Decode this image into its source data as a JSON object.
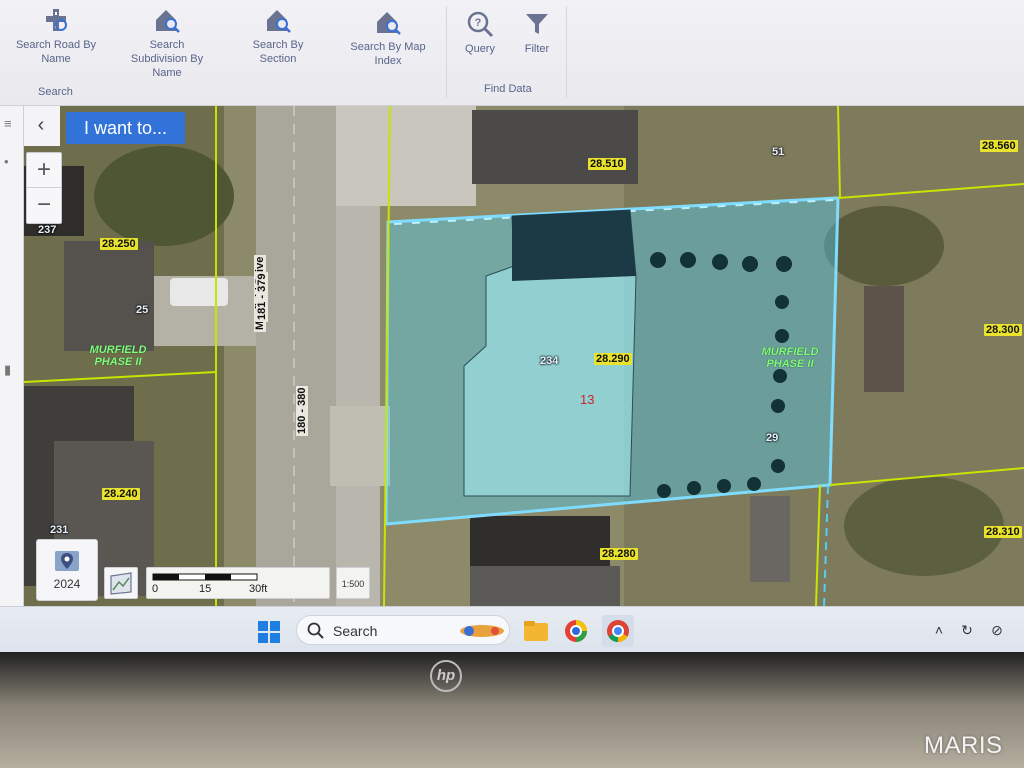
{
  "ribbon": {
    "search_group": {
      "label": "Search",
      "buttons": [
        {
          "label": "Search Road By Name",
          "icon": "road-icon"
        },
        {
          "label": "Search Subdivision By Name",
          "icon": "house-search-icon"
        },
        {
          "label": "Search By Section",
          "icon": "house-search-icon"
        },
        {
          "label": "Search By Map Index",
          "icon": "house-search-icon"
        }
      ]
    },
    "find_data_group": {
      "label": "Find Data",
      "buttons": [
        {
          "label": "Query",
          "icon": "query-search-icon"
        },
        {
          "label": "Filter",
          "icon": "filter-icon"
        }
      ]
    }
  },
  "map_ui": {
    "i_want_to_label": "I want to...",
    "zoom_in_label": "+",
    "zoom_out_label": "−",
    "year_label": "2024",
    "scale": {
      "ticks": [
        "0",
        "15",
        "30ft"
      ]
    },
    "scale_ratio": "1:500"
  },
  "map": {
    "parcel_labels": [
      "28.510",
      "28.560",
      "28.250",
      "28.290",
      "28.300",
      "28.240",
      "28.280",
      "28.310"
    ],
    "house_numbers": [
      "51",
      "237",
      "25",
      "234",
      "29",
      "231"
    ],
    "subdivision_label_left": "MURFIELD PHASE II",
    "subdivision_label_right": "MURFIELD PHASE II",
    "lot_number": "13",
    "street_name": "Murfield Drive",
    "address_range_top": "181 - 379",
    "address_range_bottom": "180 - 380"
  },
  "taskbar": {
    "search_label": "Search"
  },
  "bezel": {
    "logo_text": "hp",
    "watermark": "MARIS"
  },
  "colors": {
    "accent_blue": "#3173d9",
    "parcel_highlight": "#52d0f0",
    "parcel_line": "#c9e400",
    "subdivision_text": "#7dff7a"
  }
}
